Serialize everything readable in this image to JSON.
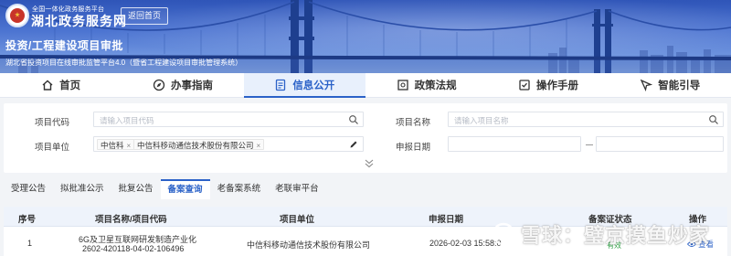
{
  "header": {
    "platform_sub": "全国一体化政务服务平台",
    "site_title": "湖北政务服务网",
    "back_button": "返回首页",
    "page_title": "投资/工程建设项目审批",
    "page_subtitle": "湖北省投资项目在线审批监管平台4.0（暨省工程建设项目审批管理系统）"
  },
  "nav": {
    "items": [
      {
        "label": "首页",
        "icon": "home-icon"
      },
      {
        "label": "办事指南",
        "icon": "compass-icon"
      },
      {
        "label": "信息公开",
        "icon": "document-icon",
        "active": true
      },
      {
        "label": "政策法规",
        "icon": "policy-icon"
      },
      {
        "label": "操作手册",
        "icon": "manual-icon"
      },
      {
        "label": "智能引导",
        "icon": "guide-icon"
      }
    ],
    "active_color": "#2b62c8"
  },
  "search": {
    "project_code": {
      "label": "项目代码",
      "placeholder": "请输入项目代码"
    },
    "project_name": {
      "label": "项目名称",
      "placeholder": "请输入项目名称"
    },
    "project_unit": {
      "label": "项目单位",
      "tags": [
        "中信科",
        "中信科移动通信技术股份有限公司"
      ]
    },
    "apply_date": {
      "label": "申报日期"
    }
  },
  "tabs": {
    "items": [
      "受理公告",
      "拟批准公示",
      "批复公告",
      "备案查询",
      "老备案系统",
      "老联审平台"
    ],
    "active_index": 3
  },
  "table": {
    "headers": [
      "序号",
      "项目名称/项目代码",
      "项目单位",
      "申报日期",
      "备案证状态",
      "操作"
    ],
    "rows": [
      {
        "index": "1",
        "project_name": "6G及卫星互联网研发制造产业化",
        "project_code": "2602-420118-04-02-106496",
        "unit": "中信科移动通信技术股份有限公司",
        "date": "2026-02-03 15:58:0",
        "status": "有效",
        "action": "查看"
      }
    ]
  },
  "watermark": {
    "text": "雪球：璧京摸鱼炒家"
  }
}
